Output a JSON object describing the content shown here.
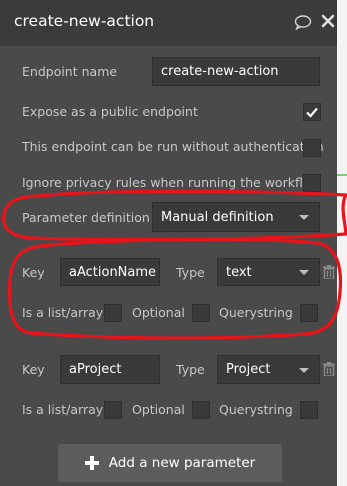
{
  "window": {
    "title": "create-new-action"
  },
  "endpoint": {
    "name_label": "Endpoint name",
    "name_value": "create-new-action",
    "public_label": "Expose as a public endpoint",
    "public_checked": true,
    "no_auth_label": "This endpoint can be run without authentication",
    "no_auth_checked": false,
    "ignore_privacy_label": "Ignore privacy rules when running the workflow",
    "ignore_privacy_checked": false
  },
  "parameter_definition": {
    "label": "Parameter definition",
    "value": "Manual definition"
  },
  "parameters": [
    {
      "key_label": "Key",
      "key_value": "aActionName",
      "type_label": "Type",
      "type_value": "text",
      "list_label": "Is a list/array",
      "optional_label": "Optional",
      "querystring_label": "Querystring",
      "list_checked": false,
      "optional_checked": false,
      "querystring_checked": false
    },
    {
      "key_label": "Key",
      "key_value": "aProject",
      "type_label": "Type",
      "type_value": "Project",
      "list_label": "Is a list/array",
      "optional_label": "Optional",
      "querystring_label": "Querystring",
      "list_checked": false,
      "optional_checked": false,
      "querystring_checked": false
    }
  ],
  "add_parameter": {
    "label": "Add a new parameter"
  },
  "icons": {
    "comment": "chat-bubble-icon",
    "close": "close-icon",
    "trash": "trash-icon",
    "check": "checkmark-icon",
    "add": "plus-icon"
  },
  "colors": {
    "panel": "#4a4a4a",
    "titlebar": "#3b3b3b",
    "field": "#3a3a3a",
    "annotation": "#e8131b"
  }
}
